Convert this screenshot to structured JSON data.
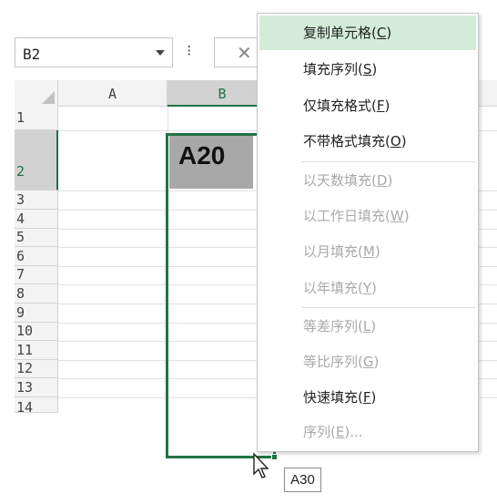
{
  "name_box": {
    "value": "B2"
  },
  "formula_bar": {
    "options_glyph": "⁝",
    "cancel_glyph": "✕"
  },
  "columns": [
    {
      "label": "A"
    },
    {
      "label": "B"
    }
  ],
  "rows": [
    {
      "label": "1"
    },
    {
      "label": "2"
    },
    {
      "label": "3"
    },
    {
      "label": "4"
    },
    {
      "label": "5"
    },
    {
      "label": "6"
    },
    {
      "label": "7"
    },
    {
      "label": "8"
    },
    {
      "label": "9"
    },
    {
      "label": "10"
    },
    {
      "label": "11"
    },
    {
      "label": "12"
    },
    {
      "label": "13"
    },
    {
      "label": "14"
    }
  ],
  "cells": {
    "B2": "A20"
  },
  "fill_tooltip": "A30",
  "context_menu": {
    "items": [
      {
        "text": "复制单元格",
        "key": "C",
        "highlighted": true,
        "disabled": false
      },
      {
        "text": "填充序列",
        "key": "S",
        "disabled": false
      },
      {
        "text": "仅填充格式",
        "key": "F",
        "disabled": false
      },
      {
        "text": "不带格式填充",
        "key": "O",
        "disabled": false
      },
      {
        "text": "以天数填充",
        "key": "D",
        "disabled": true
      },
      {
        "text": "以工作日填充",
        "key": "W",
        "disabled": true
      },
      {
        "text": "以月填充",
        "key": "M",
        "disabled": true
      },
      {
        "text": "以年填充",
        "key": "Y",
        "disabled": true
      },
      {
        "text": "等差序列",
        "key": "L",
        "disabled": true
      },
      {
        "text": "等比序列",
        "key": "G",
        "disabled": true
      },
      {
        "text": "快速填充",
        "key": "F",
        "disabled": false
      },
      {
        "text": "序列",
        "key": "E",
        "suffix": "...",
        "disabled": true
      }
    ]
  },
  "colors": {
    "accent": "#217346",
    "highlight": "#d3ecd9",
    "selected_cell": "#a8a8a8"
  }
}
